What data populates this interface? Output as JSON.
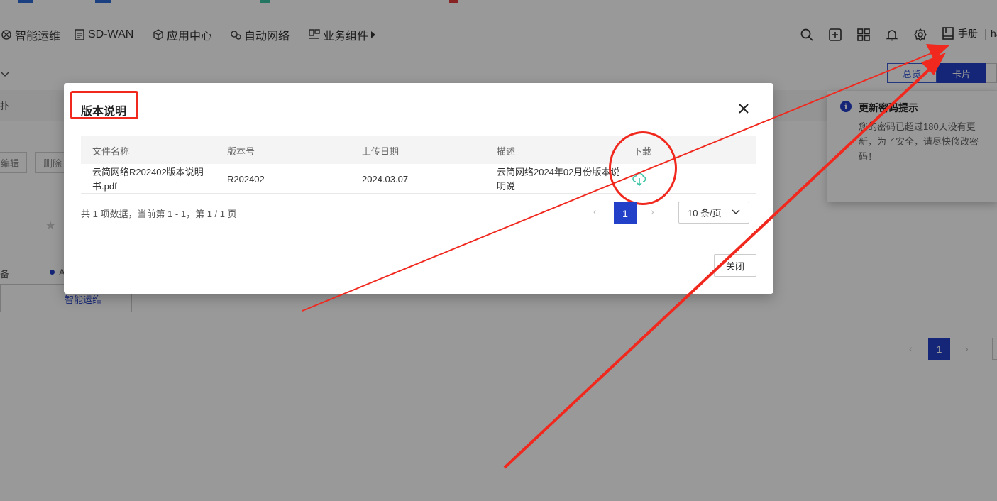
{
  "nav": {
    "items": [
      {
        "label": "智能运维",
        "icon": "cog-network-icon"
      },
      {
        "label": "SD-WAN",
        "icon": "document-list-icon"
      },
      {
        "label": "应用中心",
        "icon": "cube-icon"
      },
      {
        "label": "自动网络",
        "icon": "gears-icon"
      },
      {
        "label": "业务组件",
        "icon": "component-icon"
      }
    ],
    "manual_label": "手册",
    "user_fragment": "ha"
  },
  "view_toggle": {
    "overview": "总览",
    "card": "卡片"
  },
  "background": {
    "row3_text": "扑",
    "edit_fragment": "编辑",
    "delete_fragment": "删除",
    "legend_a": "备",
    "legend_b": "A",
    "tag_label": "智能运维",
    "page_current": "1"
  },
  "notice": {
    "icon_glyph": "i",
    "title": "更新密码提示",
    "body": "您的密码已超过180天没有更新，为了安全，请尽快修改密码！"
  },
  "modal": {
    "title": "版本说明",
    "columns": [
      "文件名称",
      "版本号",
      "上传日期",
      "描述",
      "下载"
    ],
    "rows": [
      {
        "file_name": "云简网络R202402版本说明书.pdf",
        "version": "R202402",
        "upload_date": "2024.03.07",
        "description": "云简网络2024年02月份版本说明说"
      }
    ],
    "pagination": {
      "summary": "共 1 项数据，当前第 1 - 1，第 1 / 1 页",
      "prev": "‹",
      "current": "1",
      "next": "›",
      "page_size": "10 条/页"
    },
    "close_label": "关闭"
  },
  "colors": {
    "accent": "#2340c9",
    "annotation": "#f0281e",
    "download_icon": "#3ec4a6"
  }
}
